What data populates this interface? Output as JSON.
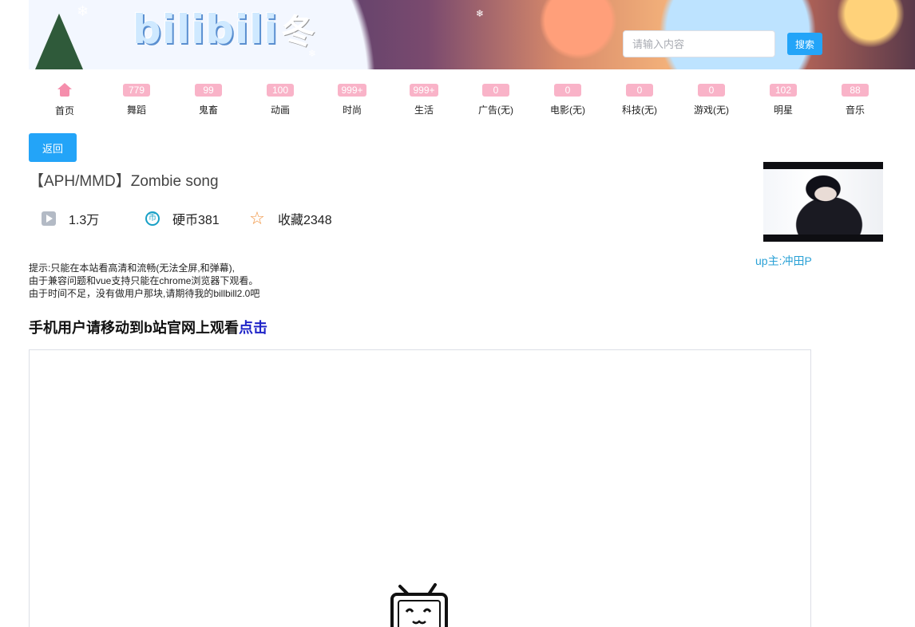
{
  "header": {
    "logo_text": "bilibili",
    "logo_suffix": "冬",
    "search_placeholder": "请输入内容",
    "search_value": "",
    "search_button": "搜索"
  },
  "nav": {
    "items": [
      {
        "label": "首页",
        "badge": "",
        "icon": "home-icon"
      },
      {
        "label": "舞蹈",
        "badge": "779"
      },
      {
        "label": "鬼畜",
        "badge": "99"
      },
      {
        "label": "动画",
        "badge": "100"
      },
      {
        "label": "时尚",
        "badge": "999+"
      },
      {
        "label": "生活",
        "badge": "999+"
      },
      {
        "label": "广告(无)",
        "badge": "0"
      },
      {
        "label": "电影(无)",
        "badge": "0"
      },
      {
        "label": "科技(无)",
        "badge": "0"
      },
      {
        "label": "游戏(无)",
        "badge": "0"
      },
      {
        "label": "明星",
        "badge": "102"
      },
      {
        "label": "音乐",
        "badge": "88"
      }
    ]
  },
  "back_button": "返回",
  "video": {
    "title": "【APH/MMD】Zombie song",
    "plays": "1.3万",
    "coins": "硬币381",
    "favorites": "收藏2348",
    "coin_icon_glyph": "币",
    "uploader": "up主:冲田P"
  },
  "tips": {
    "line1": "提示:只能在本站看高清和流畅(无法全屏,和弹幕),",
    "line2": "由于兼容问题和vue支持只能在chrome浏览器下观看。",
    "line3": "由于时间不足，没有做用户那块,请期待我的billbill2.0吧"
  },
  "mobile_hint": {
    "text": "手机用户请移动到b站官网上观看",
    "link": "点击"
  },
  "colors": {
    "accent_blue": "#23a4f8",
    "badge_pink": "#f9b3c8",
    "link_cyan": "#2aa1d6",
    "link_dark_blue": "#1f24c8",
    "star_orange": "#f0913c"
  }
}
